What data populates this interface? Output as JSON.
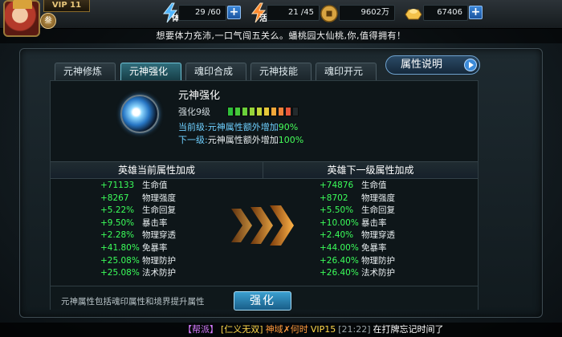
{
  "hud": {
    "vip": "VIP 11",
    "level_badge": "叁",
    "stamina": {
      "label": "体",
      "value": "29 /60"
    },
    "vitality": {
      "label": "活",
      "value": "21 /45"
    },
    "coins": {
      "value": "9602万"
    },
    "ingots": {
      "value": "67406"
    }
  },
  "announcement": "想要体力充沛,一口气闯五关么。蟠桃园大仙桃,你,值得拥有！",
  "tabs": [
    {
      "label": "元神修炼",
      "active": false
    },
    {
      "label": "元神强化",
      "active": true
    },
    {
      "label": "魂印合成",
      "active": false
    },
    {
      "label": "元神技能",
      "active": false
    },
    {
      "label": "魂印开元",
      "active": false
    }
  ],
  "info_button": "属性说明",
  "skill": {
    "title": "元神强化",
    "level_text": "强化9级",
    "current_label": "当前级:",
    "current_text": "元神属性额外增加",
    "current_value": "90%",
    "next_label": "下一级:",
    "next_text": "元神属性额外增加",
    "next_value": "100%",
    "level_bar": {
      "filled": 9,
      "total": 10,
      "colors": [
        "#2fbf3a",
        "#46c83a",
        "#6ad03a",
        "#96d43a",
        "#c2d43a",
        "#e6c83a",
        "#f0a83a",
        "#f0823a",
        "#e8563a",
        "#2a2a2a"
      ]
    }
  },
  "current_attrs": {
    "header": "英雄当前属性加成",
    "rows": [
      {
        "value": "+71133",
        "name": "生命值"
      },
      {
        "value": "+8267",
        "name": "物理强度"
      },
      {
        "value": "+5.22%",
        "name": "生命回复"
      },
      {
        "value": "+9.50%",
        "name": "暴击率"
      },
      {
        "value": "+2.28%",
        "name": "物理穿透"
      },
      {
        "value": "+41.80%",
        "name": "免暴率"
      },
      {
        "value": "+25.08%",
        "name": "物理防护"
      },
      {
        "value": "+25.08%",
        "name": "法术防护"
      }
    ]
  },
  "next_attrs": {
    "header": "英雄下一级属性加成",
    "rows": [
      {
        "value": "+74876",
        "name": "生命值"
      },
      {
        "value": "+8702",
        "name": "物理强度"
      },
      {
        "value": "+5.50%",
        "name": "生命回复"
      },
      {
        "value": "+10.00%",
        "name": "暴击率"
      },
      {
        "value": "+2.40%",
        "name": "物理穿透"
      },
      {
        "value": "+44.00%",
        "name": "免暴率"
      },
      {
        "value": "+26.40%",
        "name": "物理防护"
      },
      {
        "value": "+26.40%",
        "name": "法术防护"
      }
    ]
  },
  "footer": {
    "note": "元神属性包括魂印属性和境界提升属性",
    "button": "强化"
  },
  "chat": {
    "channel": "【帮派】",
    "guild": "[仁义无双]",
    "name": "神域✗何时",
    "vip": "VIP15",
    "time": "[21:22]",
    "message": "在打牌忘记时间了"
  },
  "colors": {
    "accent": "#6fc3d6",
    "gain_green": "#3bff5a",
    "info_blue": "#6fd0ff",
    "chat_channel": "#d77bff",
    "chat_guild": "#ffd84a",
    "chat_name": "#ff9a3c",
    "chat_vip": "#ffd84a",
    "chat_time": "#9aa4a8"
  }
}
